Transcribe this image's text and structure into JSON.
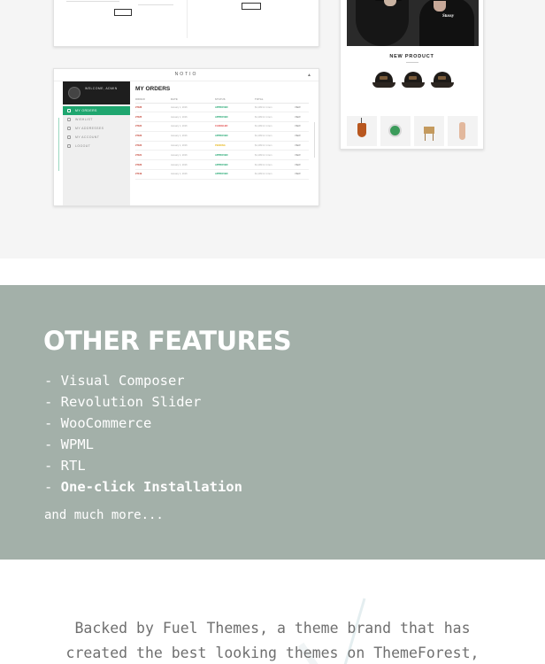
{
  "showcase": {
    "dashboard": {
      "brand": "NOTIO",
      "welcome": "WELCOME, ADMIN",
      "menu": [
        "MY ORDERS",
        "WISHLIST",
        "MY ADDRESSES",
        "MY ACCOUNT",
        "LOGOUT"
      ],
      "title": "MY ORDERS",
      "columns": [
        "ORDER",
        "DATE",
        "STATUS",
        "TOTAL",
        ""
      ],
      "orders": [
        {
          "num": "#7426",
          "date": "January 1, 2016",
          "status": "APPROVED",
          "status_color": "#1fa66f",
          "total": "$1,199 for 1 item",
          "action": "VIEW"
        },
        {
          "num": "#7425",
          "date": "January 1, 2016",
          "status": "APPROVED",
          "status_color": "#1fa66f",
          "total": "$1,199 for 1 item",
          "action": "VIEW"
        },
        {
          "num": "#7424",
          "date": "January 1, 2016",
          "status": "CANCELED",
          "status_color": "#e04848",
          "total": "$1,199 for 1 item",
          "action": "VIEW"
        },
        {
          "num": "#7423",
          "date": "January 1, 2016",
          "status": "APPROVED",
          "status_color": "#1fa66f",
          "total": "$1,199 for 1 item",
          "action": "VIEW"
        },
        {
          "num": "#7422",
          "date": "January 1, 2016",
          "status": "PENDING",
          "status_color": "#e8b923",
          "total": "$1,199 for 1 item",
          "action": "VIEW"
        },
        {
          "num": "#7421",
          "date": "January 1, 2016",
          "status": "APPROVED",
          "status_color": "#1fa66f",
          "total": "$1,199 for 1 item",
          "action": "VIEW"
        },
        {
          "num": "#7420",
          "date": "January 1, 2016",
          "status": "APPROVED",
          "status_color": "#1fa66f",
          "total": "$1,199 for 1 item",
          "action": "VIEW"
        },
        {
          "num": "#7419",
          "date": "January 1, 2016",
          "status": "APPROVED",
          "status_color": "#1fa66f",
          "total": "$1,199 for 1 item",
          "action": "VIEW"
        }
      ]
    },
    "product": {
      "heading": "NEW PRODUCT",
      "hero_logo": "Stussy"
    }
  },
  "features": {
    "title": "OTHER FEATURES",
    "items": [
      "- Visual Composer",
      "- Revolution Slider",
      "- WooCommerce",
      "- WPML",
      "- RTL"
    ],
    "last_prefix": "- ",
    "last_item": "One-click Installation",
    "more": "and much more..."
  },
  "about": {
    "line1": "Backed by Fuel Themes, a theme brand that has",
    "line2": "created the best looking themes on ThemeForest,"
  },
  "colors": {
    "features_bg": "#a3b0a9",
    "accent_green": "#1fa66f",
    "about_text": "#6f6f6f"
  }
}
